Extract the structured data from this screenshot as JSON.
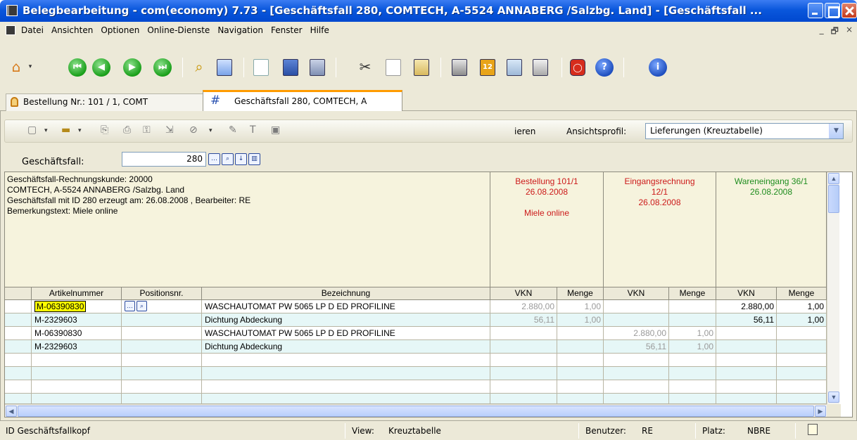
{
  "window": {
    "title": "Belegbearbeitung - com(economy) 7.73 - [Geschäftsfall 280, COMTECH, A-5524 ANNABERG /Salzbg. Land] - [Geschäftsfall ..."
  },
  "menu": [
    "Datei",
    "Ansichten",
    "Optionen",
    "Online-Dienste",
    "Navigation",
    "Fenster",
    "Hilfe"
  ],
  "mdi_controls": [
    "_",
    "🗗",
    "×"
  ],
  "tabs": [
    {
      "label": "Bestellung Nr.: 101 / 1, COMT",
      "icon": "lock-icon"
    },
    {
      "label": "Geschäftsfall 280, COMTECH, A",
      "icon": "grid-icon"
    }
  ],
  "subtoolbar": {
    "truncated_label": "ieren",
    "profile_label": "Ansichtsprofil:",
    "profile_value": "Lieferungen (Kreuztabelle)"
  },
  "geschaeftsfall": {
    "label": "Geschäftsfall:",
    "value": "280"
  },
  "info": {
    "line1": "Geschäftsfall-Rechnungskunde: 20000",
    "line2": "COMTECH, A-5524 ANNABERG /Salzbg. Land",
    "line3": "Geschäftsfall mit ID 280 erzeugt am: 26.08.2008 , Bearbeiter: RE",
    "line4": "Bemerkungstext: Miele online"
  },
  "docs": [
    {
      "line1": "Bestellung 101/1",
      "line2": "26.08.2008",
      "line3": "",
      "line4": "Miele online",
      "color": "#cc1a1a"
    },
    {
      "line1": "Eingangsrechnung",
      "line2": "12/1",
      "line3": "26.08.2008",
      "line4": "",
      "color": "#cc1a1a"
    },
    {
      "line1": "Wareneingang 36/1",
      "line2": "26.08.2008",
      "line3": "",
      "line4": "",
      "color": "#1f8d1f"
    }
  ],
  "columns": {
    "artikel": "Artikelnummer",
    "pos": "Positionsnr.",
    "bez": "Bezeichnung",
    "vkn": "VKN",
    "menge": "Menge"
  },
  "rows": [
    {
      "artikel": "M-06390830",
      "bez": "WASCHAUTOMAT PW 5065 LP D ED PROFILINE",
      "vkn1": "2.880,00",
      "m1": "1,00",
      "vkn2": "",
      "m2": "",
      "vkn3": "2.880,00",
      "m3": "1,00"
    },
    {
      "artikel": "M-2329603",
      "bez": "Dichtung Abdeckung",
      "vkn1": "56,11",
      "m1": "1,00",
      "vkn2": "",
      "m2": "",
      "vkn3": "56,11",
      "m3": "1,00"
    },
    {
      "artikel": "M-06390830",
      "bez": "WASCHAUTOMAT PW 5065 LP D ED PROFILINE",
      "vkn1": "",
      "m1": "",
      "vkn2": "2.880,00",
      "m2": "1,00",
      "vkn3": "",
      "m3": ""
    },
    {
      "artikel": "M-2329603",
      "bez": "Dichtung Abdeckung",
      "vkn1": "",
      "m1": "",
      "vkn2": "56,11",
      "m2": "1,00",
      "vkn3": "",
      "m3": ""
    }
  ],
  "statusbar": {
    "left": "ID Geschäftsfallkopf",
    "view_label": "View:",
    "view_value": "Kreuztabelle",
    "user_label": "Benutzer:",
    "user_value": "RE",
    "platz_label": "Platz:",
    "platz_value": "NBRE"
  },
  "colors": {
    "title_blue": "#0a57dc",
    "info_bg": "#f6f3dd",
    "selected_cell": "#ffff00",
    "row_tint": "#e6f7f7",
    "red_doc": "#cc1a1a",
    "green_doc": "#1f8d1f"
  }
}
